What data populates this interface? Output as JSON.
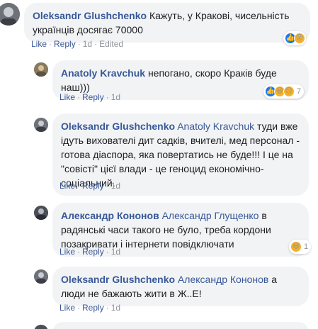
{
  "comments": [
    {
      "author": "Oleksandr Glushchenko",
      "mention": "",
      "text": "Кажуть, у Кракові, чисельність українців досягає 70000",
      "actions": {
        "like": "Like",
        "reply": "Reply",
        "time": "1d",
        "extra": "Edited"
      },
      "reactions": {
        "icons": [
          "like-icon",
          "wow-icon"
        ],
        "count": ""
      }
    },
    {
      "author": "Anatoly Kravchuk",
      "mention": "",
      "text": "непогано, скоро Краків буде наш)))",
      "actions": {
        "like": "Like",
        "reply": "Reply",
        "time": "1d"
      },
      "reactions": {
        "icons": [
          "like-icon",
          "haha-icon",
          "sad-icon"
        ],
        "count": "7"
      }
    },
    {
      "author": "Oleksandr Glushchenko",
      "mention": "Anatoly Kravchuk",
      "text": "туди вже ідуть вихователі дит садків, вчителі, мед персонал - готова діаспора, яка повертатись не буде!!! І це на \"совісті\" цієї влади - це геноцид економічно-соціальний.",
      "actions": {
        "like": "Like",
        "reply": "Reply",
        "time": "1d"
      }
    },
    {
      "author": "Александр Кононов",
      "mention": "Александр Глущенко",
      "text": "в радянські часи такого не було, треба кордони позакривати і інтернети повідключати",
      "actions": {
        "like": "Like",
        "reply": "Reply",
        "time": "1d"
      },
      "reactions": {
        "icons": [
          "laugh-icon"
        ],
        "count": "1"
      }
    },
    {
      "author": "Oleksandr Glushchenko",
      "mention": "Александр Кононов",
      "text": "а люди не бажають жити в Ж..Е!",
      "actions": {
        "like": "Like",
        "reply": "Reply",
        "time": "1d"
      }
    }
  ],
  "colors": {
    "link": "#385898",
    "bubble": "#f2f3f5",
    "meta": "#90949c",
    "like": "#1877f2",
    "emoji": "#f7b125"
  }
}
